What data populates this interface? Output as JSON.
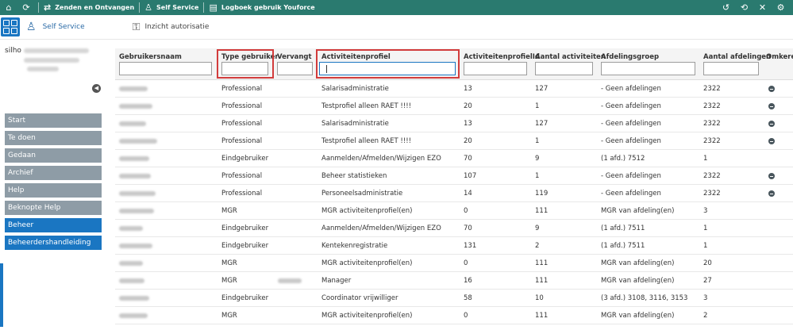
{
  "topbar": {
    "items": [
      {
        "label": "Zenden en Ontvangen",
        "icon": "send-receive-icon"
      },
      {
        "label": "Self Service",
        "icon": "person-icon"
      },
      {
        "label": "Logboek gebruik Youforce",
        "icon": "book-icon"
      }
    ],
    "right_icons": [
      "logout-icon",
      "history-icon",
      "tools-icon",
      "settings-icon"
    ],
    "color": "#2a7a6f"
  },
  "subbar": {
    "user_label": "Self Service",
    "link_label": "Inzicht autorisatie"
  },
  "sidebar": {
    "username": "silho",
    "menu": [
      {
        "label": "Start",
        "active": false
      },
      {
        "label": "Te doen",
        "active": false
      },
      {
        "label": "Gedaan",
        "active": false
      },
      {
        "label": "Archief",
        "active": false
      },
      {
        "label": "Help",
        "active": false
      },
      {
        "label": "Beknopte Help",
        "active": false
      },
      {
        "label": "Beheer",
        "active": true
      },
      {
        "label": "Beheerdershandleiding",
        "active": true
      }
    ]
  },
  "table": {
    "columns": [
      "Gebruikersnaam",
      "Type gebruiker",
      "Vervangt",
      "Activiteitenprofiel",
      "ActiviteitenprofielId",
      "Aantal activiteiten",
      "Afdelingsgroep",
      "Aantal afdelingen",
      "Omkeren"
    ],
    "rows": [
      {
        "type": "Professional",
        "vervangt": "",
        "profiel": "Salarisadministratie",
        "id": "13",
        "aantal": "127",
        "groep": "- Geen afdelingen",
        "afd": "2322",
        "omkeren": true
      },
      {
        "type": "Professional",
        "vervangt": "",
        "profiel": "Testprofiel alleen RAET !!!!",
        "id": "20",
        "aantal": "1",
        "groep": "- Geen afdelingen",
        "afd": "2322",
        "omkeren": true
      },
      {
        "type": "Professional",
        "vervangt": "",
        "profiel": "Salarisadministratie",
        "id": "13",
        "aantal": "127",
        "groep": "- Geen afdelingen",
        "afd": "2322",
        "omkeren": true
      },
      {
        "type": "Professional",
        "vervangt": "",
        "profiel": "Testprofiel alleen RAET !!!!",
        "id": "20",
        "aantal": "1",
        "groep": "- Geen afdelingen",
        "afd": "2322",
        "omkeren": true
      },
      {
        "type": "Eindgebruiker",
        "vervangt": "",
        "profiel": "Aanmelden/Afmelden/Wijzigen EZO",
        "id": "70",
        "aantal": "9",
        "groep": "(1 afd.) 7512",
        "afd": "1",
        "omkeren": false
      },
      {
        "type": "Professional",
        "vervangt": "",
        "profiel": "Beheer statistieken",
        "id": "107",
        "aantal": "1",
        "groep": "- Geen afdelingen",
        "afd": "2322",
        "omkeren": true
      },
      {
        "type": "Professional",
        "vervangt": "",
        "profiel": "Personeelsadministratie",
        "id": "14",
        "aantal": "119",
        "groep": "- Geen afdelingen",
        "afd": "2322",
        "omkeren": true
      },
      {
        "type": "MGR",
        "vervangt": "",
        "profiel": "MGR activiteitenprofiel(en)",
        "id": "0",
        "aantal": "111",
        "groep": "MGR van afdeling(en)",
        "afd": "3",
        "omkeren": false
      },
      {
        "type": "Eindgebruiker",
        "vervangt": "",
        "profiel": "Aanmelden/Afmelden/Wijzigen EZO",
        "id": "70",
        "aantal": "9",
        "groep": "(1 afd.) 7511",
        "afd": "1",
        "omkeren": false
      },
      {
        "type": "Eindgebruiker",
        "vervangt": "",
        "profiel": "Kentekenregistratie",
        "id": "131",
        "aantal": "2",
        "groep": "(1 afd.) 7511",
        "afd": "1",
        "omkeren": false
      },
      {
        "type": "MGR",
        "vervangt": "",
        "profiel": "MGR activiteitenprofiel(en)",
        "id": "0",
        "aantal": "111",
        "groep": "MGR van afdeling(en)",
        "afd": "20",
        "omkeren": false
      },
      {
        "type": "MGR",
        "vervangt": "blurred",
        "profiel": "Manager",
        "id": "16",
        "aantal": "111",
        "groep": "MGR van afdeling(en)",
        "afd": "27",
        "omkeren": false
      },
      {
        "type": "Eindgebruiker",
        "vervangt": "",
        "profiel": "Coordinator vrijwilliger",
        "id": "58",
        "aantal": "10",
        "groep": "(3 afd.) 3108, 3116, 3153",
        "afd": "3",
        "omkeren": false
      },
      {
        "type": "MGR",
        "vervangt": "",
        "profiel": "MGR activiteitenprofiel(en)",
        "id": "0",
        "aantal": "111",
        "groep": "MGR van afdeling(en)",
        "afd": "2",
        "omkeren": false
      }
    ]
  },
  "colors": {
    "accent": "#1a76c2",
    "highlight": "#d23c3c",
    "menu": "#8e9ca6"
  }
}
